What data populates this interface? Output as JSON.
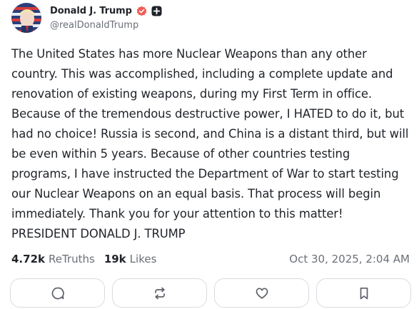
{
  "author": {
    "name": "Donald J. Trump",
    "handle": "@realDonaldTrump",
    "verified_icon": "verified-check-icon",
    "verified_color": "#f25c54",
    "plus_icon": "plus-badge-icon"
  },
  "post": {
    "text": "The United States has more Nuclear Weapons than any other country. This was accomplished, including a complete update and renovation of existing weapons, during my First Term in office. Because of the tremendous destructive power, I HATED to do it, but had no choice! Russia is second, and China is a distant third, but will be even within 5 years. Because of other countries testing programs, I have instructed the Department of War to start testing our Nuclear Weapons on an equal basis. That process will begin immediately. Thank you for your attention to this matter! PRESIDENT DONALD J. TRUMP",
    "retruths_count": "4.72k",
    "retruths_label": "ReTruths",
    "likes_count": "19k",
    "likes_label": "Likes",
    "timestamp": "Oct 30, 2025, 2:04 AM"
  },
  "actions": [
    {
      "icon": "reply-icon"
    },
    {
      "icon": "retruth-icon"
    },
    {
      "icon": "like-icon"
    },
    {
      "icon": "bookmark-icon"
    }
  ],
  "colors": {
    "text": "#1f2329",
    "muted": "#6b6f78",
    "border": "#d8dbe0",
    "icon": "#5c6069"
  }
}
